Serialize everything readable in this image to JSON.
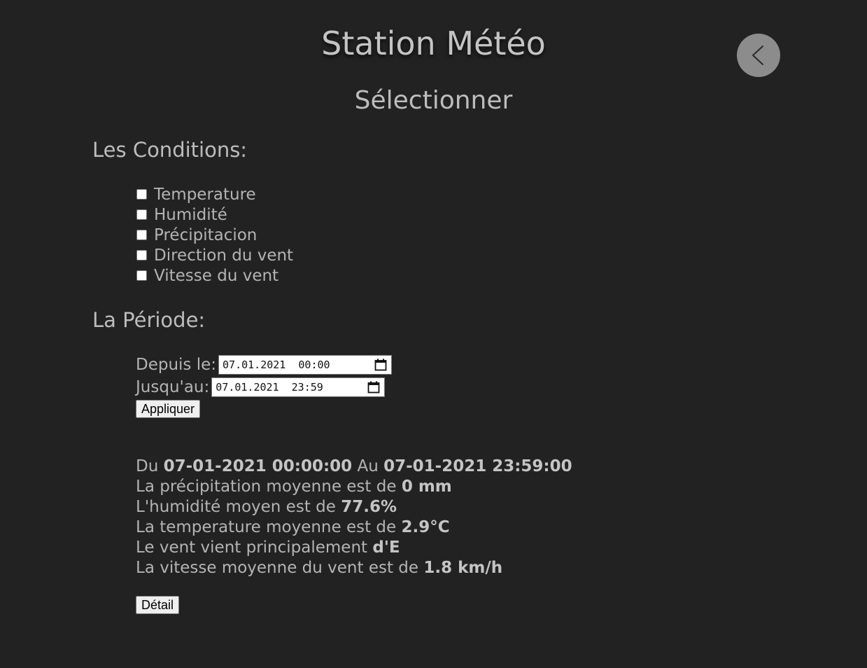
{
  "header": {
    "title": "Station Météo",
    "subtitle": "Sélectionner",
    "back_icon": "chevron-left-icon"
  },
  "conditions": {
    "heading": "Les Conditions:",
    "items": [
      {
        "label": "Temperature",
        "checked": false
      },
      {
        "label": "Humidité",
        "checked": false
      },
      {
        "label": "Précipitacion",
        "checked": false
      },
      {
        "label": "Direction du vent",
        "checked": false
      },
      {
        "label": "Vitesse du vent",
        "checked": false
      }
    ]
  },
  "period": {
    "heading": "La Période:",
    "from_label": "Depuis le:",
    "from_value": "07.01.2021  00:00",
    "to_label": "Jusqu'au:",
    "to_value": "07.01.2021  23:59",
    "apply_label": "Appliquer",
    "calendar_icon": "calendar-icon"
  },
  "results": {
    "range_prefix": "Du ",
    "range_from": "07-01-2021 00:00:00",
    "range_mid": " Au ",
    "range_to": "07-01-2021 23:59:00",
    "precip_text": "La précipitation moyenne est de ",
    "precip_value": "0 mm",
    "humidity_text": "L'humidité moyen est de ",
    "humidity_value": "77.6%",
    "temp_text": "La temperature moyenne est de ",
    "temp_value": "2.9°C",
    "wind_dir_text": "Le vent vient principalement ",
    "wind_dir_value": "d'E",
    "wind_speed_text": "La vitesse moyenne du vent est de ",
    "wind_speed_value": "1.8 km/h",
    "detail_label": "Détail"
  },
  "colors": {
    "background": "#222222",
    "text": "#b4b4b4",
    "back_button": "#8c8c8c"
  }
}
